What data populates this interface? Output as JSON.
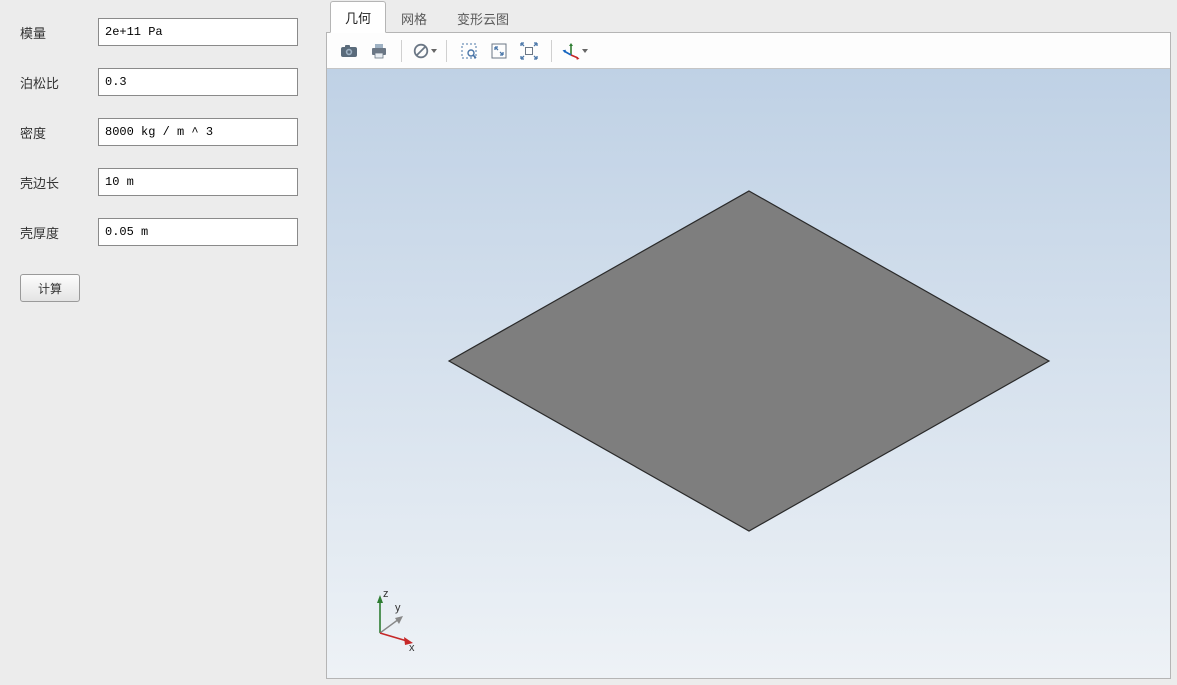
{
  "form": {
    "fields": [
      {
        "label": "模量",
        "value": "2e+11 Pa"
      },
      {
        "label": "泊松比",
        "value": "0.3"
      },
      {
        "label": "密度",
        "value": "8000 kg / m ^ 3"
      },
      {
        "label": "壳边长",
        "value": "10 m"
      },
      {
        "label": "壳厚度",
        "value": "0.05 m"
      }
    ],
    "calc_button": "计算"
  },
  "tabs": [
    {
      "label": "几何",
      "active": true
    },
    {
      "label": "网格",
      "active": false
    },
    {
      "label": "变形云图",
      "active": false
    }
  ],
  "toolbar": {
    "icons": [
      "camera",
      "print",
      "sep",
      "forbidden-dd",
      "sep",
      "zoom-box",
      "fit-view",
      "zoom-extents",
      "sep",
      "axes-dd"
    ]
  },
  "axis": {
    "x": "x",
    "y": "y",
    "z": "z"
  }
}
